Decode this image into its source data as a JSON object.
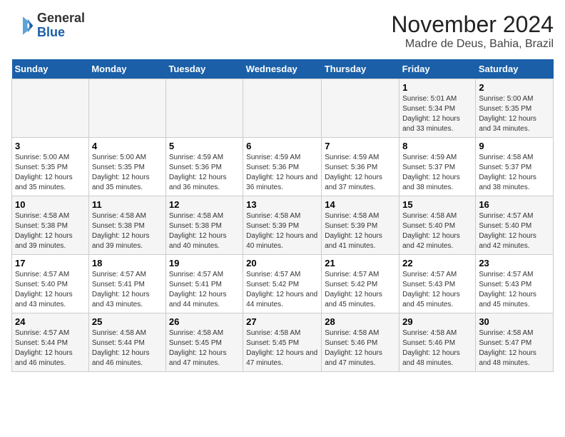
{
  "logo": {
    "general": "General",
    "blue": "Blue"
  },
  "header": {
    "month": "November 2024",
    "location": "Madre de Deus, Bahia, Brazil"
  },
  "weekdays": [
    "Sunday",
    "Monday",
    "Tuesday",
    "Wednesday",
    "Thursday",
    "Friday",
    "Saturday"
  ],
  "weeks": [
    [
      {
        "day": "",
        "info": ""
      },
      {
        "day": "",
        "info": ""
      },
      {
        "day": "",
        "info": ""
      },
      {
        "day": "",
        "info": ""
      },
      {
        "day": "",
        "info": ""
      },
      {
        "day": "1",
        "info": "Sunrise: 5:01 AM\nSunset: 5:34 PM\nDaylight: 12 hours and 33 minutes."
      },
      {
        "day": "2",
        "info": "Sunrise: 5:00 AM\nSunset: 5:35 PM\nDaylight: 12 hours and 34 minutes."
      }
    ],
    [
      {
        "day": "3",
        "info": "Sunrise: 5:00 AM\nSunset: 5:35 PM\nDaylight: 12 hours and 35 minutes."
      },
      {
        "day": "4",
        "info": "Sunrise: 5:00 AM\nSunset: 5:35 PM\nDaylight: 12 hours and 35 minutes."
      },
      {
        "day": "5",
        "info": "Sunrise: 4:59 AM\nSunset: 5:36 PM\nDaylight: 12 hours and 36 minutes."
      },
      {
        "day": "6",
        "info": "Sunrise: 4:59 AM\nSunset: 5:36 PM\nDaylight: 12 hours and 36 minutes."
      },
      {
        "day": "7",
        "info": "Sunrise: 4:59 AM\nSunset: 5:36 PM\nDaylight: 12 hours and 37 minutes."
      },
      {
        "day": "8",
        "info": "Sunrise: 4:59 AM\nSunset: 5:37 PM\nDaylight: 12 hours and 38 minutes."
      },
      {
        "day": "9",
        "info": "Sunrise: 4:58 AM\nSunset: 5:37 PM\nDaylight: 12 hours and 38 minutes."
      }
    ],
    [
      {
        "day": "10",
        "info": "Sunrise: 4:58 AM\nSunset: 5:38 PM\nDaylight: 12 hours and 39 minutes."
      },
      {
        "day": "11",
        "info": "Sunrise: 4:58 AM\nSunset: 5:38 PM\nDaylight: 12 hours and 39 minutes."
      },
      {
        "day": "12",
        "info": "Sunrise: 4:58 AM\nSunset: 5:38 PM\nDaylight: 12 hours and 40 minutes."
      },
      {
        "day": "13",
        "info": "Sunrise: 4:58 AM\nSunset: 5:39 PM\nDaylight: 12 hours and 40 minutes."
      },
      {
        "day": "14",
        "info": "Sunrise: 4:58 AM\nSunset: 5:39 PM\nDaylight: 12 hours and 41 minutes."
      },
      {
        "day": "15",
        "info": "Sunrise: 4:58 AM\nSunset: 5:40 PM\nDaylight: 12 hours and 42 minutes."
      },
      {
        "day": "16",
        "info": "Sunrise: 4:57 AM\nSunset: 5:40 PM\nDaylight: 12 hours and 42 minutes."
      }
    ],
    [
      {
        "day": "17",
        "info": "Sunrise: 4:57 AM\nSunset: 5:40 PM\nDaylight: 12 hours and 43 minutes."
      },
      {
        "day": "18",
        "info": "Sunrise: 4:57 AM\nSunset: 5:41 PM\nDaylight: 12 hours and 43 minutes."
      },
      {
        "day": "19",
        "info": "Sunrise: 4:57 AM\nSunset: 5:41 PM\nDaylight: 12 hours and 44 minutes."
      },
      {
        "day": "20",
        "info": "Sunrise: 4:57 AM\nSunset: 5:42 PM\nDaylight: 12 hours and 44 minutes."
      },
      {
        "day": "21",
        "info": "Sunrise: 4:57 AM\nSunset: 5:42 PM\nDaylight: 12 hours and 45 minutes."
      },
      {
        "day": "22",
        "info": "Sunrise: 4:57 AM\nSunset: 5:43 PM\nDaylight: 12 hours and 45 minutes."
      },
      {
        "day": "23",
        "info": "Sunrise: 4:57 AM\nSunset: 5:43 PM\nDaylight: 12 hours and 45 minutes."
      }
    ],
    [
      {
        "day": "24",
        "info": "Sunrise: 4:57 AM\nSunset: 5:44 PM\nDaylight: 12 hours and 46 minutes."
      },
      {
        "day": "25",
        "info": "Sunrise: 4:58 AM\nSunset: 5:44 PM\nDaylight: 12 hours and 46 minutes."
      },
      {
        "day": "26",
        "info": "Sunrise: 4:58 AM\nSunset: 5:45 PM\nDaylight: 12 hours and 47 minutes."
      },
      {
        "day": "27",
        "info": "Sunrise: 4:58 AM\nSunset: 5:45 PM\nDaylight: 12 hours and 47 minutes."
      },
      {
        "day": "28",
        "info": "Sunrise: 4:58 AM\nSunset: 5:46 PM\nDaylight: 12 hours and 47 minutes."
      },
      {
        "day": "29",
        "info": "Sunrise: 4:58 AM\nSunset: 5:46 PM\nDaylight: 12 hours and 48 minutes."
      },
      {
        "day": "30",
        "info": "Sunrise: 4:58 AM\nSunset: 5:47 PM\nDaylight: 12 hours and 48 minutes."
      }
    ]
  ]
}
